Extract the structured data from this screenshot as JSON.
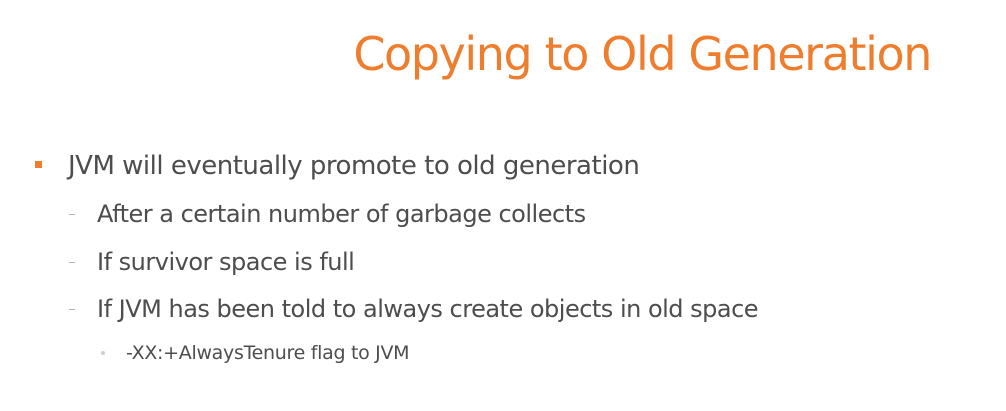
{
  "slide": {
    "title": "Copying to Old Generation",
    "bullets": [
      "JVM will eventually promote to old generation",
      "After a certain number of garbage collects",
      "If survivor space is full",
      "If JVM has been told to always create objects in old space",
      "-XX:+AlwaysTenure flag to JVM"
    ]
  },
  "colors": {
    "accent": "#ef7d2e",
    "text": "#4d4d4d"
  },
  "icons": {
    "level1_marker": "orange-square-bullet-icon",
    "level2_marker": "dash-bullet-icon",
    "level3_marker": "dot-bullet-icon"
  }
}
